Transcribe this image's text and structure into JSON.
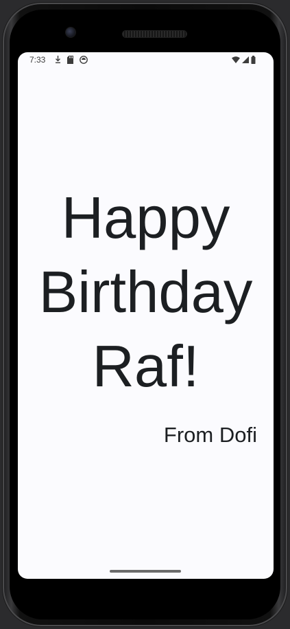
{
  "status_bar": {
    "time": "7:33",
    "left_icons": [
      "download-icon",
      "sd-card-icon",
      "app-notification-icon"
    ],
    "right_icons": [
      "wifi-icon",
      "cell-signal-icon",
      "battery-icon"
    ]
  },
  "card": {
    "greeting": "Happy Birthday Raf!",
    "signature": "From Dofi"
  },
  "colors": {
    "screen_background": "#fbfbfe",
    "text": "#1c1f22",
    "nav_handle": "#6b6b6b"
  }
}
